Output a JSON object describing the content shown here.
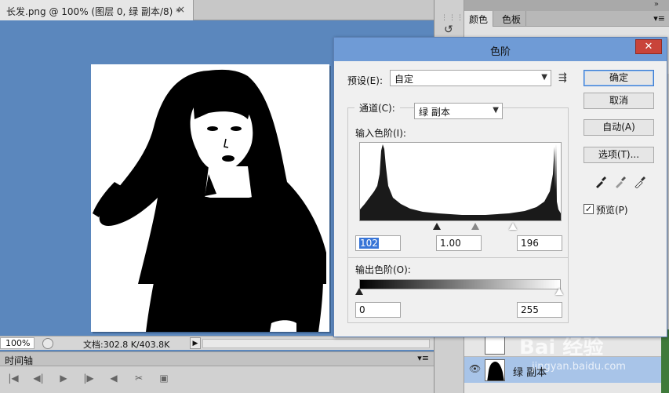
{
  "document": {
    "tab_title": "长发.png @ 100% (图层 0, 绿 副本/8) *",
    "close_glyph": "×"
  },
  "status_bar": {
    "zoom": "100%",
    "doc_info": "文档:302.8 K/403.8K"
  },
  "timeline": {
    "label": "时间轴",
    "controls": [
      "|◀",
      "◀|",
      "▶",
      "|▶",
      "◀",
      "✂",
      "▣"
    ]
  },
  "right_panel": {
    "tabs": [
      {
        "label": "颜色",
        "active": true
      },
      {
        "label": "色板",
        "active": false
      }
    ],
    "layers": [
      {
        "name": "绿 副本",
        "selected": true,
        "visible": true
      }
    ]
  },
  "watermark": {
    "logo": "Bai 经验",
    "url": "jingyan.baidu.com"
  },
  "levels_dialog": {
    "title": "色阶",
    "close_glyph": "✕",
    "preset_label": "预设(E):",
    "preset_value": "自定",
    "channel_label": "通道(C):",
    "channel_value": "绿 副本",
    "input_levels_label": "输入色阶(I):",
    "input_black": "102",
    "input_gamma": "1.00",
    "input_white": "196",
    "output_levels_label": "输出色阶(O):",
    "output_black": "0",
    "output_white": "255",
    "buttons": {
      "ok": "确定",
      "cancel": "取消",
      "auto": "自动(A)",
      "options": "选项(T)..."
    },
    "preview_label": "预览(P)",
    "preview_checked": true
  },
  "colors": {
    "canvas_bg": "#5b87bd",
    "dialog_title_bg": "#6f9bd6",
    "close_btn": "#c9443a",
    "selected_layer": "#a8c4e8",
    "selection_highlight": "#3875d7"
  }
}
